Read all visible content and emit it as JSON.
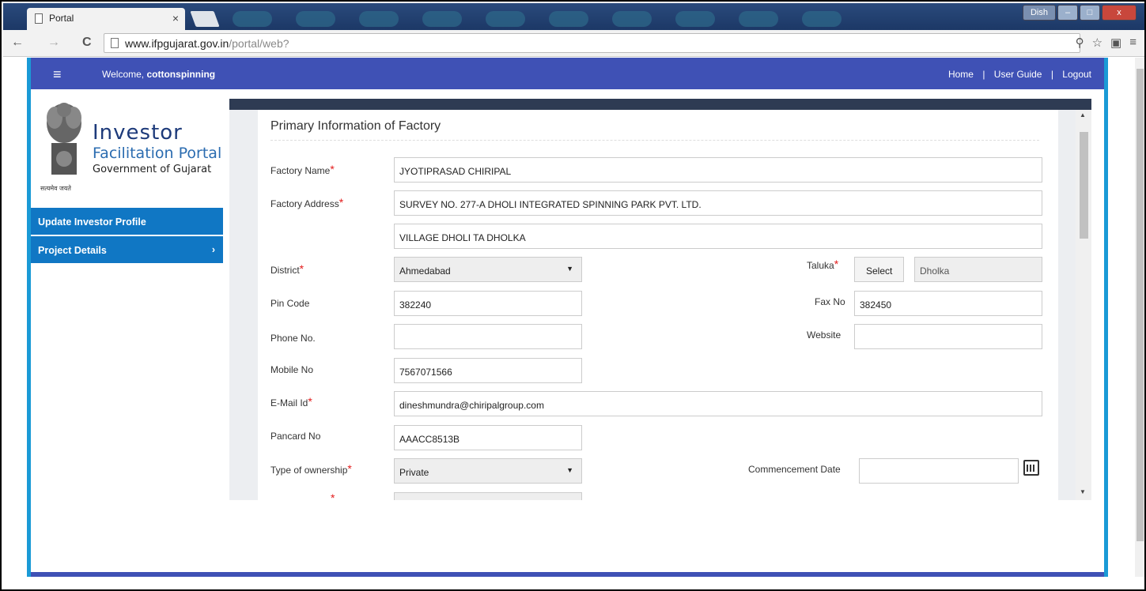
{
  "browser": {
    "tab_title": "Portal",
    "tab_close": "×",
    "url_host": "www.ifpgujarat.gov.in",
    "url_path": "/portal/web?",
    "user_chip": "Dish",
    "nav": {
      "back": "←",
      "forward": "→",
      "reload": "C"
    },
    "icons": [
      "key-icon",
      "star-icon",
      "extension-icon",
      "menu-icon"
    ]
  },
  "header": {
    "menu_glyph": "≡",
    "welcome_label": "Welcome,",
    "username": "cottonspinning",
    "links": {
      "home": "Home",
      "sep1": "|",
      "user_guide": "User Guide",
      "sep2": "|",
      "logout": "Logout"
    }
  },
  "logo": {
    "line1": "Investor",
    "line2": "Facilitation Portal",
    "line3": "Government of Gujarat",
    "motto": "सत्यमेव जयते"
  },
  "sidebar": {
    "items": [
      {
        "label": "Update Investor Profile"
      },
      {
        "label": "Project Details",
        "chevron": "›"
      }
    ]
  },
  "form": {
    "title": "Primary Information of Factory",
    "required_mark": "*",
    "factory_name": {
      "label": "Factory Name",
      "value": "JYOTIPRASAD CHIRIPAL"
    },
    "factory_address": {
      "label": "Factory Address",
      "line1": "SURVEY NO. 277-A DHOLI INTEGRATED SPINNING PARK PVT. LTD.",
      "line2": "VILLAGE DHOLI TA DHOLKA"
    },
    "district": {
      "label": "District",
      "value": "Ahmedabad",
      "arrow": "▼"
    },
    "taluka": {
      "label": "Taluka",
      "button": "Select",
      "value": "Dholka"
    },
    "pin_code": {
      "label": "Pin Code",
      "value": "382240"
    },
    "fax_no": {
      "label": "Fax No",
      "value": "382450"
    },
    "phone_no": {
      "label": "Phone No.",
      "value": ""
    },
    "website": {
      "label": "Website",
      "value": ""
    },
    "mobile_no": {
      "label": "Mobile No",
      "value": "7567071566"
    },
    "email": {
      "label": "E-Mail Id",
      "value": "dineshmundra@chiripalgroup.com"
    },
    "pancard": {
      "label": "Pancard No",
      "value": "AAACC8513B"
    },
    "ownership": {
      "label": "Type of ownership",
      "value": "Private",
      "arrow": "▼"
    },
    "commencement_date": {
      "label": "Commencement Date",
      "value": ""
    }
  },
  "colors": {
    "header": "#3f51b5",
    "sidebar": "#1077c4",
    "frame": "#1a9ad6",
    "required": "#e31b1b"
  }
}
